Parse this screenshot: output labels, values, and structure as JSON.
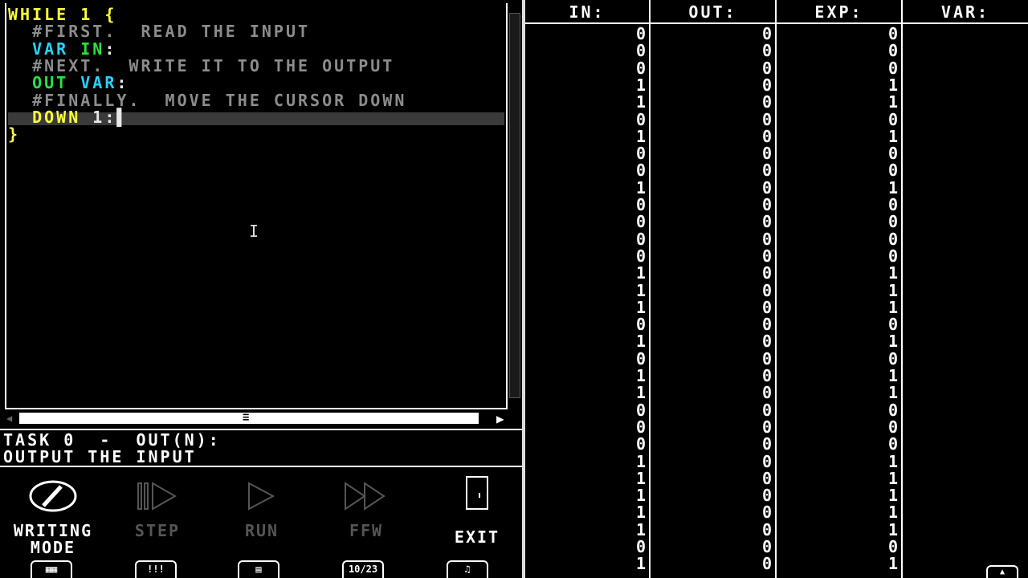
{
  "editor": {
    "lines": [
      {
        "segments": [
          {
            "t": "WHILE 1 {",
            "c": "kw"
          }
        ]
      },
      {
        "segments": [
          {
            "t": "  #FIRST.  READ THE INPUT",
            "c": "cmt"
          }
        ]
      },
      {
        "segments": [
          {
            "t": "  VAR ",
            "c": "var"
          },
          {
            "t": "IN",
            "c": "grn"
          },
          {
            "t": ":",
            "c": "wht"
          }
        ]
      },
      {
        "segments": [
          {
            "t": "  #NEXT.  WRITE IT TO THE OUTPUT",
            "c": "cmt"
          }
        ]
      },
      {
        "segments": [
          {
            "t": "  OUT ",
            "c": "grn"
          },
          {
            "t": "VAR",
            "c": "var"
          },
          {
            "t": ":",
            "c": "wht"
          }
        ]
      },
      {
        "segments": [
          {
            "t": "  #FINALLY.  MOVE THE CURSOR DOWN",
            "c": "cmt"
          }
        ]
      },
      {
        "segments": [
          {
            "t": "  DOWN ",
            "c": "kw"
          },
          {
            "t": "1:",
            "c": "wht"
          },
          {
            "t": "▌",
            "c": "wht"
          }
        ]
      },
      {
        "segments": [
          {
            "t": "}",
            "c": "kw"
          }
        ]
      }
    ]
  },
  "task": {
    "line1": "TASK 0  -  OUT(N):",
    "line2": "OUTPUT THE INPUT"
  },
  "buttons": {
    "writing": {
      "label1": "WRITING",
      "label2": "MODE",
      "icon": "pencil-icon"
    },
    "step": {
      "label": "STEP",
      "icon": "step-icon"
    },
    "run": {
      "label": "RUN",
      "icon": "play-icon"
    },
    "ffw": {
      "label": "FFW",
      "icon": "fast-forward-icon"
    },
    "exit": {
      "label": "EXIT",
      "icon": "door-icon"
    }
  },
  "bottom_icons": [
    "keyboard-icon",
    "pause-icon",
    "tape-icon",
    "counter-icon",
    "music-icon"
  ],
  "bottom_icon_text": {
    "counter": "10/23"
  },
  "table": {
    "headers": [
      "IN:",
      "OUT:",
      "EXP:",
      "VAR:"
    ],
    "in": [
      0,
      0,
      0,
      1,
      1,
      0,
      1,
      0,
      0,
      1,
      0,
      0,
      0,
      0,
      1,
      1,
      1,
      0,
      1,
      0,
      1,
      1,
      0,
      0,
      0,
      1,
      1,
      1,
      1,
      1,
      0,
      1
    ],
    "out": [
      0,
      0,
      0,
      0,
      0,
      0,
      0,
      0,
      0,
      0,
      0,
      0,
      0,
      0,
      0,
      0,
      0,
      0,
      0,
      0,
      0,
      0,
      0,
      0,
      0,
      0,
      0,
      0,
      0,
      0,
      0,
      0
    ],
    "exp": [
      0,
      0,
      0,
      1,
      1,
      0,
      1,
      0,
      0,
      1,
      0,
      0,
      0,
      0,
      1,
      1,
      1,
      0,
      1,
      0,
      1,
      1,
      0,
      0,
      0,
      1,
      1,
      1,
      1,
      1,
      0,
      1
    ]
  },
  "colors": {
    "keyword": "#ffff3c",
    "variable": "#28d2ff",
    "io": "#30e040",
    "comment": "#8c8c8c"
  }
}
